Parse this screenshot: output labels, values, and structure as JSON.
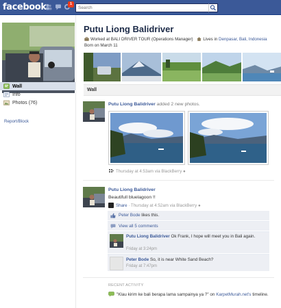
{
  "topbar": {
    "logo": "facebook",
    "notification_count": "1",
    "search_placeholder": "Search"
  },
  "sidebar": {
    "items": [
      {
        "label": "Wall"
      },
      {
        "label": "Info"
      },
      {
        "label": "Photos (76)"
      }
    ],
    "report_link": "Report/Block"
  },
  "profile": {
    "name": "Putu Liong Balidriver",
    "work": "Worked at BALI DRIVER TOUR (Operations Manager)",
    "lives_prefix": "Lives in",
    "location": "Denpasar, Bali, Indonesia",
    "born": "Born on March 11"
  },
  "wall": {
    "header": "Wall"
  },
  "story1": {
    "author": "Putu Liong Balidriver",
    "action": "added 2 new photos.",
    "meta": "Thursday at 4:53am via BlackBerry"
  },
  "story2": {
    "author": "Putu Liong Balidriver",
    "text": "Beautifull bluelagoon !!",
    "share": "Share",
    "meta": "· Thursday at 4:52am via BlackBerry"
  },
  "feedback": {
    "like_name": "Peter Bode",
    "like_suffix": "likes this.",
    "view_all": "View all 5 comments",
    "comments": [
      {
        "author": "Putu Liong Balidriver",
        "text": "Ok Frank, I hope will meet you in Bali again.",
        "time": "Friday at 3:24pm"
      },
      {
        "author": "Peter Bode",
        "text": "So, it is near White Sand Beach?",
        "time": "Friday at 7:47pm"
      }
    ]
  },
  "recent": {
    "label": "RECENT ACTIVITY",
    "text": "\"Klau kirim ke bali berapa lama sampainya ya ?\" on",
    "link": "KarpetMurah.net's",
    "suffix": "timeline."
  },
  "colors": {
    "brand": "#3b5998",
    "feedback_bg": "#edeff4"
  }
}
